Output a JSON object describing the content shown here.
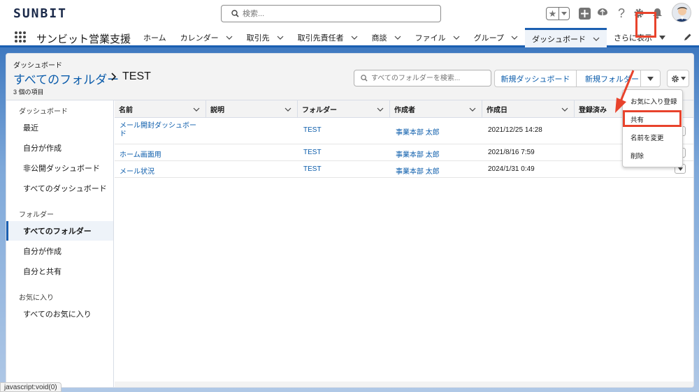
{
  "global": {
    "logo": "SUNBIT",
    "search_placeholder": "検索...",
    "icons": [
      "favorites-star-icon",
      "add-icon",
      "trailhead-icon",
      "help-icon",
      "settings-icon",
      "notifications-bell-icon",
      "user-avatar"
    ]
  },
  "app_nav": {
    "app_name": "サンビット営業支援",
    "items": [
      {
        "label": "ホーム",
        "has_menu": false
      },
      {
        "label": "カレンダー",
        "has_menu": true
      },
      {
        "label": "取引先",
        "has_menu": true
      },
      {
        "label": "取引先責任者",
        "has_menu": true
      },
      {
        "label": "商談",
        "has_menu": true
      },
      {
        "label": "ファイル",
        "has_menu": true
      },
      {
        "label": "グループ",
        "has_menu": true
      },
      {
        "label": "ダッシュボード",
        "has_menu": true,
        "active": true
      },
      {
        "label": "さらに表示",
        "has_menu": true
      }
    ]
  },
  "header": {
    "eyebrow": "ダッシュボード",
    "breadcrumb_link": "すべてのフォルダー",
    "current": "TEST",
    "count": "3 個の項目",
    "folder_search_placeholder": "すべてのフォルダーを検索...",
    "new_dashboard": "新規ダッシュボード",
    "new_folder": "新規フォルダー"
  },
  "sidebar": {
    "sections": [
      {
        "title": "ダッシュボード",
        "items": [
          "最近",
          "自分が作成",
          "非公開ダッシュボード",
          "すべてのダッシュボード"
        ]
      },
      {
        "title": "フォルダー",
        "items": [
          "すべてのフォルダー",
          "自分が作成",
          "自分と共有"
        ]
      },
      {
        "title": "お気に入り",
        "items": [
          "すべてのお気に入り"
        ]
      }
    ],
    "active_item": "すべてのフォルダー"
  },
  "table": {
    "columns": [
      "名前",
      "説明",
      "フォルダー",
      "作成者",
      "作成日",
      "登録済み"
    ],
    "rows": [
      {
        "name_line1": "メール開封ダッシュボー",
        "name_line2": "ド",
        "description": "",
        "folder": "TEST",
        "created_by": "事業本部 太郎",
        "created_date": "2021/12/25 14:28"
      },
      {
        "name_line1": "ホーム画面用",
        "name_line2": "",
        "description": "",
        "folder": "TEST",
        "created_by": "事業本部 太郎",
        "created_date": "2021/8/16 7:59"
      },
      {
        "name_line1": "メール状況",
        "name_line2": "",
        "description": "",
        "folder": "TEST",
        "created_by": "事業本部 太郎",
        "created_date": "2024/1/31 0:49"
      }
    ]
  },
  "dropdown": {
    "items": [
      "お気に入り登録",
      "共有",
      "名前を変更",
      "削除"
    ],
    "highlighted": "共有"
  },
  "annotation_color": "#e8432c",
  "statusbar": "javascript:void(0)"
}
